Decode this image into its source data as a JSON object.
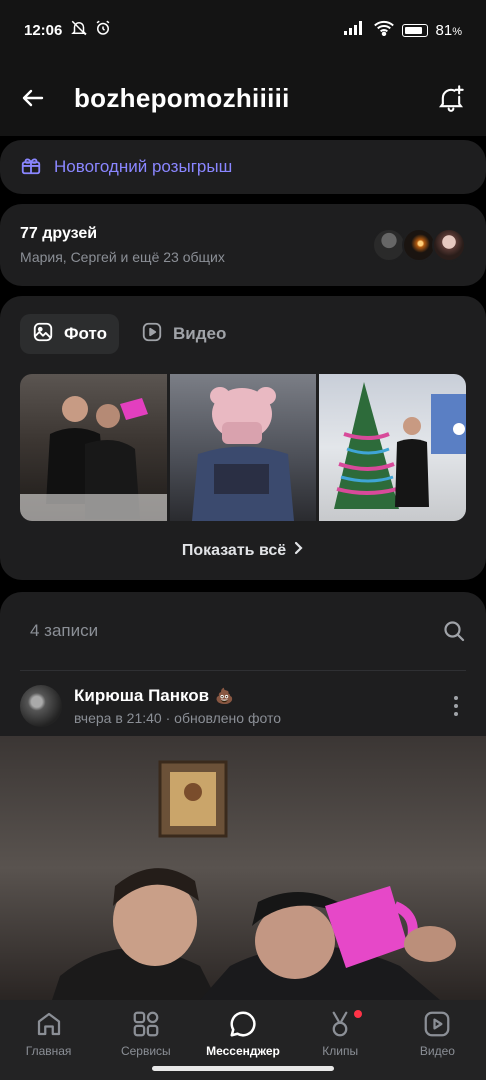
{
  "status": {
    "time": "12:06",
    "battery": "81",
    "battery_pct_sign": "%"
  },
  "header": {
    "title": "bozhepomozhiiiii"
  },
  "gift_banner": {
    "label": "Новогодний розыгрыш"
  },
  "friends": {
    "count_label": "77 друзей",
    "mutual_label": "Мария, Сергей и ещё 23 общих"
  },
  "media": {
    "tabs": [
      {
        "label": "Фото",
        "active": true
      },
      {
        "label": "Видео",
        "active": false
      }
    ],
    "show_all_label": "Показать всё"
  },
  "wall": {
    "count_label": "4 записи",
    "post": {
      "author": "Кирюша Панков",
      "author_emoji": "💩",
      "time": "вчера в 21:40 · обновлено фото"
    }
  },
  "tabbar": {
    "items": [
      {
        "label": "Главная",
        "icon": "home-icon",
        "active": false
      },
      {
        "label": "Сервисы",
        "icon": "services-icon",
        "active": false
      },
      {
        "label": "Мессенджер",
        "icon": "messenger-icon",
        "active": true
      },
      {
        "label": "Клипы",
        "icon": "clips-icon",
        "active": false,
        "badge": true
      },
      {
        "label": "Видео",
        "icon": "video-icon",
        "active": false
      }
    ]
  },
  "colors": {
    "accent": "#8a86ff",
    "card_bg": "#1e1e1f",
    "badge": "#ff3347"
  }
}
